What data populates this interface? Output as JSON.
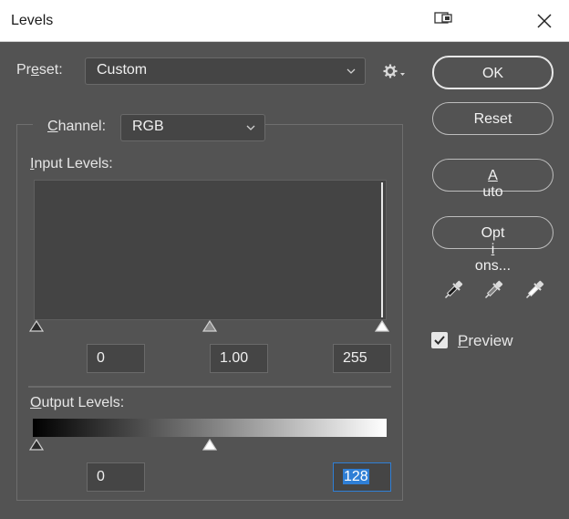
{
  "window": {
    "title": "Levels"
  },
  "preset": {
    "label_pre": "Pr",
    "label_mnemonic": "e",
    "label_post": "set:",
    "value": "Custom"
  },
  "channel": {
    "label_pre": "",
    "label_mnemonic": "C",
    "label_post": "hannel:",
    "value": "RGB"
  },
  "input_levels": {
    "label_pre": "",
    "label_mnemonic": "I",
    "label_post": "nput Levels:",
    "black": "0",
    "gamma": "1.00",
    "white": "255"
  },
  "output_levels": {
    "label_pre": "",
    "label_mnemonic": "O",
    "label_post": "utput Levels:",
    "black": "0",
    "white": "128"
  },
  "buttons": {
    "ok": "OK",
    "reset": "Reset",
    "auto_pre": "",
    "auto_mnemonic": "A",
    "auto_post": "uto",
    "options_pre": "Opt",
    "options_mnemonic": "i",
    "options_post": "ons..."
  },
  "preview": {
    "label_pre": "",
    "label_mnemonic": "P",
    "label_post": "review",
    "checked": true
  },
  "icons": [
    "restore-icon",
    "close-icon",
    "gear-icon",
    "chevron-down-icon",
    "black-point-eyedropper-icon",
    "gray-point-eyedropper-icon",
    "white-point-eyedropper-icon",
    "checkmark-icon"
  ]
}
